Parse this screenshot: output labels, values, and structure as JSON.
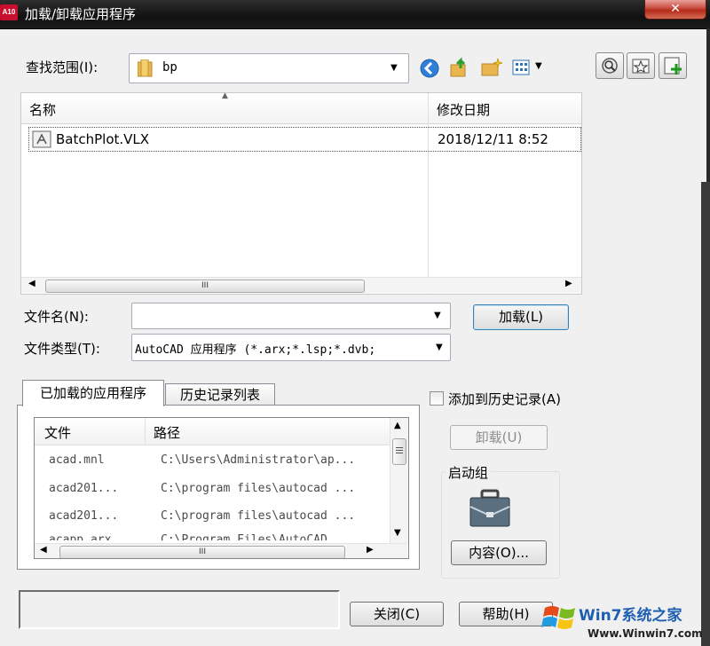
{
  "window": {
    "title": "加载/卸载应用程序",
    "app_icon": "A10",
    "close": "✕"
  },
  "lookin": {
    "label": "查找范围(I):",
    "value": "bp"
  },
  "toolbar": {
    "icons": [
      "back-icon",
      "up-folder-icon",
      "new-folder-icon",
      "views-icon"
    ],
    "right_icons": [
      "search-web-icon",
      "favorites-icon",
      "add-favorite-icon"
    ]
  },
  "filelist": {
    "columns": [
      "名称",
      "修改日期"
    ],
    "rows": [
      {
        "name": "BatchPlot.VLX",
        "date": "2018/12/11 8:52"
      }
    ],
    "scroll_thumb": "III"
  },
  "filename": {
    "label": "文件名(N):",
    "value": ""
  },
  "filetype": {
    "label": "文件类型(T):",
    "value": "AutoCAD 应用程序 (*.arx;*.lsp;*.dvb;"
  },
  "load_button": "加载(L)",
  "tabs": [
    "已加载的应用程序",
    "历史记录列表"
  ],
  "apptable": {
    "columns": [
      "文件",
      "路径"
    ],
    "rows": [
      {
        "file": "acad.mnl",
        "path": "C:\\Users\\Administrator\\ap..."
      },
      {
        "file": "acad201...",
        "path": "C:\\program files\\autocad ..."
      },
      {
        "file": "acad201...",
        "path": "C:\\program files\\autocad ..."
      },
      {
        "file": "acapp.arx",
        "path": "C:\\Program Files\\AutoCAD ..."
      }
    ],
    "scroll_thumb": "III"
  },
  "history_checkbox": {
    "label": "添加到历史记录(A)",
    "checked": false
  },
  "unload_button": "卸载(U)",
  "startup": {
    "label": "启动组",
    "contents_button": "内容(O)..."
  },
  "close_button": "关闭(C)",
  "help_button": "帮助(H)",
  "watermark": {
    "brand": "Win7系统之家",
    "url": "Www.Winwin7.com"
  },
  "colors": {
    "selection": "#3399ff",
    "title_bg": "#1c1c1c",
    "close_red": "#c74a3c"
  }
}
